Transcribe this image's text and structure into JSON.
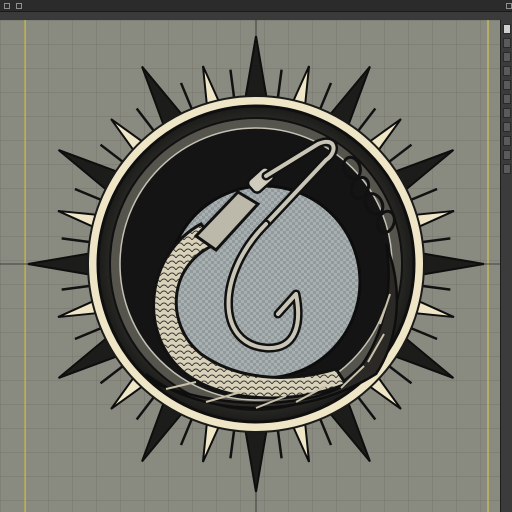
{
  "app": {
    "menu_items": [
      "",
      "",
      "",
      ""
    ],
    "active_tool": "artboard"
  },
  "artwork": {
    "subject": "fish-hook-emblem",
    "colors": {
      "background": "#8a8b80",
      "grid": "#6f7068",
      "guide_yellow": "#e3d24a",
      "cream": "#efe6c8",
      "ink": "#141414",
      "metal": "#b9b8ad",
      "center_fill": "#9fa6a8"
    }
  },
  "panel": {
    "tools": [
      "tool-1",
      "tool-2",
      "tool-3",
      "tool-4",
      "tool-5",
      "tool-6",
      "tool-7",
      "tool-8",
      "tool-9",
      "tool-10",
      "tool-11"
    ]
  }
}
